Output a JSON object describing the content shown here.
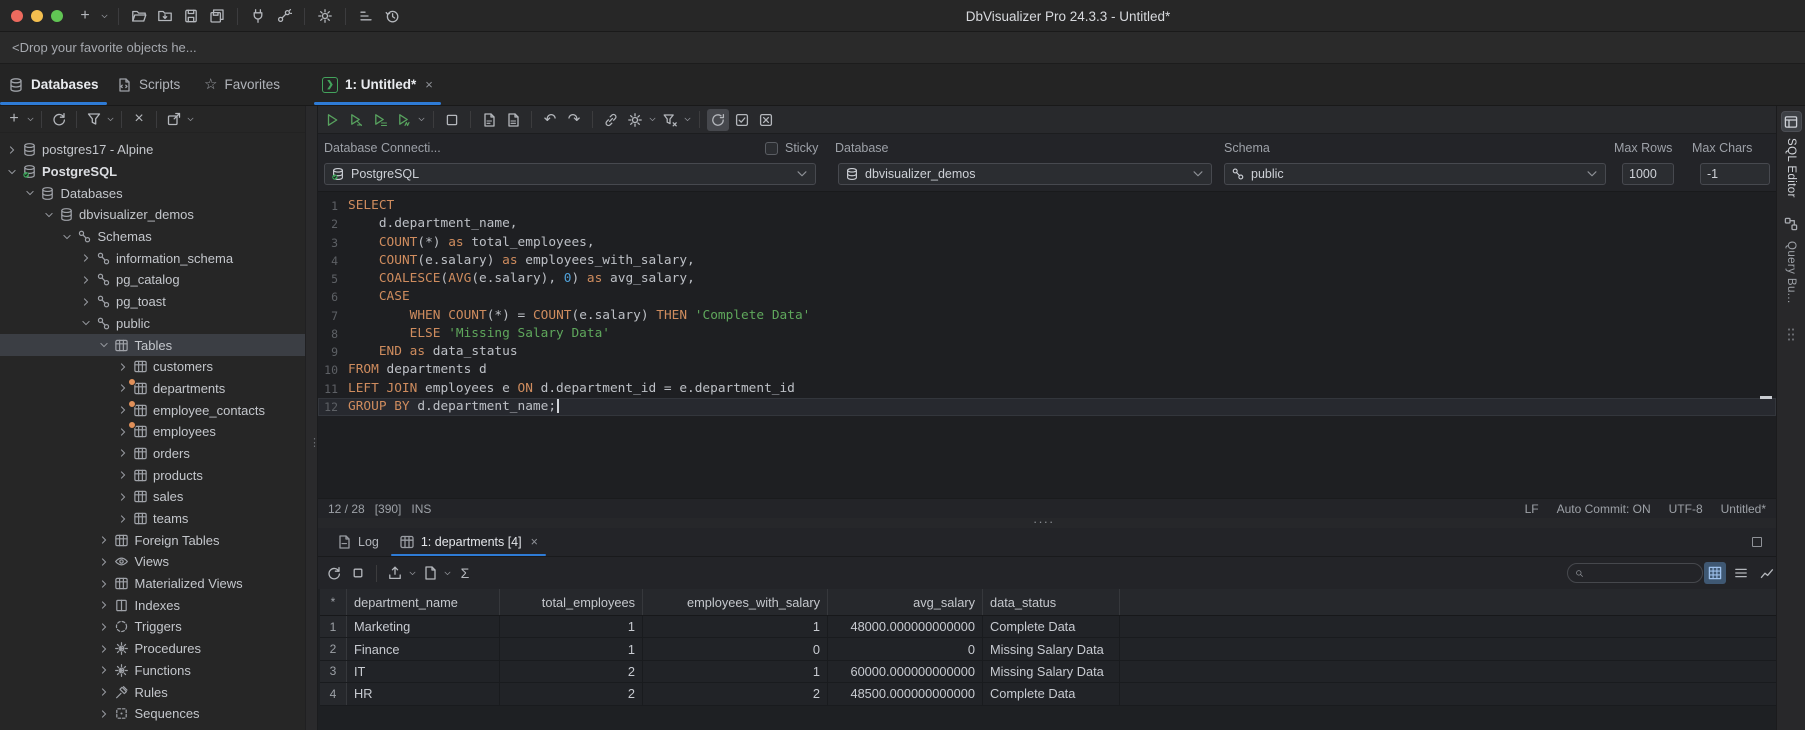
{
  "window": {
    "title": "DbVisualizer Pro 24.3.3 - Untitled*"
  },
  "titlebar": {
    "icons": [
      "plus",
      "chev",
      "|",
      "folder-open",
      "folder-import",
      "save",
      "save-all",
      "|",
      "plug",
      "connector",
      "|",
      "gear",
      "|",
      "chart-bars",
      "history"
    ]
  },
  "dropbar": {
    "text": "<Drop your favorite objects he..."
  },
  "tabs": {
    "left": [
      {
        "label": "Databases",
        "icon": "database",
        "active": true
      },
      {
        "label": "Scripts",
        "icon": "script",
        "active": false
      },
      {
        "label": "Favorites",
        "icon": "star",
        "active": false
      }
    ],
    "editor_tab": {
      "label": "1: Untitled*",
      "icon": "sql-badge",
      "close": "x",
      "active": true
    }
  },
  "sidebar": {
    "toolbar": [
      "plus",
      "chev",
      "|",
      "refresh",
      "|",
      "funnel",
      "chev",
      "|",
      "close",
      "|",
      "open-new",
      "chev"
    ],
    "tree": [
      {
        "label": "postgres17 - Alpine",
        "level": 0,
        "exp": "closed",
        "icon": "database"
      },
      {
        "label": "PostgreSQL",
        "level": 0,
        "exp": "open",
        "icon": "database-check",
        "bold": true
      },
      {
        "label": "Databases",
        "level": 1,
        "exp": "open",
        "icon": "database"
      },
      {
        "label": "dbvisualizer_demos",
        "level": 2,
        "exp": "open",
        "icon": "database"
      },
      {
        "label": "Schemas",
        "level": 3,
        "exp": "open",
        "icon": "schema"
      },
      {
        "label": "information_schema",
        "level": 4,
        "exp": "closed",
        "icon": "schema"
      },
      {
        "label": "pg_catalog",
        "level": 4,
        "exp": "closed",
        "icon": "schema"
      },
      {
        "label": "pg_toast",
        "level": 4,
        "exp": "closed",
        "icon": "schema"
      },
      {
        "label": "public",
        "level": 4,
        "exp": "open",
        "icon": "schema"
      },
      {
        "label": "Tables",
        "level": 5,
        "exp": "open",
        "icon": "table",
        "selected": true
      },
      {
        "label": "customers",
        "level": 6,
        "exp": "closed",
        "icon": "table"
      },
      {
        "label": "departments",
        "level": 6,
        "exp": "closed",
        "icon": "table",
        "badge": true
      },
      {
        "label": "employee_contacts",
        "level": 6,
        "exp": "closed",
        "icon": "table",
        "badge": true
      },
      {
        "label": "employees",
        "level": 6,
        "exp": "closed",
        "icon": "table",
        "badge": true
      },
      {
        "label": "orders",
        "level": 6,
        "exp": "closed",
        "icon": "table"
      },
      {
        "label": "products",
        "level": 6,
        "exp": "closed",
        "icon": "table"
      },
      {
        "label": "sales",
        "level": 6,
        "exp": "closed",
        "icon": "table"
      },
      {
        "label": "teams",
        "level": 6,
        "exp": "closed",
        "icon": "table"
      },
      {
        "label": "Foreign Tables",
        "level": 5,
        "exp": "closed",
        "icon": "table"
      },
      {
        "label": "Views",
        "level": 5,
        "exp": "closed",
        "icon": "eye"
      },
      {
        "label": "Materialized Views",
        "level": 5,
        "exp": "closed",
        "icon": "table"
      },
      {
        "label": "Indexes",
        "level": 5,
        "exp": "closed",
        "icon": "columns"
      },
      {
        "label": "Triggers",
        "level": 5,
        "exp": "closed",
        "icon": "trigger"
      },
      {
        "label": "Procedures",
        "level": 5,
        "exp": "closed",
        "icon": "gear-play"
      },
      {
        "label": "Functions",
        "level": 5,
        "exp": "closed",
        "icon": "gear-play"
      },
      {
        "label": "Rules",
        "level": 5,
        "exp": "closed",
        "icon": "hammer"
      },
      {
        "label": "Sequences",
        "level": 5,
        "exp": "closed",
        "icon": "sequence"
      }
    ]
  },
  "editor": {
    "toolbar": [
      {
        "ic": "play"
      },
      {
        "ic": "play-cursor"
      },
      {
        "ic": "play-script"
      },
      {
        "ic": "play-explain"
      },
      "chev",
      "|",
      {
        "ic": "stop"
      },
      "|",
      {
        "ic": "format-doc"
      },
      {
        "ic": "format-doc-alt"
      },
      "|",
      {
        "ic": "undo"
      },
      {
        "ic": "redo"
      },
      "|",
      {
        "ic": "link"
      },
      {
        "ic": "gear"
      },
      "chev",
      {
        "ic": "funnel-x"
      },
      "chev",
      "|",
      {
        "ic": "commit-check",
        "active": true
      },
      {
        "ic": "check-square"
      },
      {
        "ic": "x-square"
      }
    ],
    "connection": {
      "connection_label": "Database Connecti...",
      "sticky_label": "Sticky",
      "database_label": "Database",
      "schema_label": "Schema",
      "max_rows_label": "Max Rows",
      "max_chars_label": "Max Chars",
      "connection_value": "PostgreSQL",
      "database_value": "dbvisualizer_demos",
      "schema_value": "public",
      "max_rows_value": "1000",
      "max_chars_value": "-1"
    },
    "code": {
      "current_line": 12,
      "lines": [
        {
          "n": "1",
          "seg": [
            [
              "k",
              "SELECT"
            ]
          ]
        },
        {
          "n": "2",
          "seg": [
            [
              "d",
              "    d.department_name,"
            ]
          ]
        },
        {
          "n": "3",
          "seg": [
            [
              "d",
              "    "
            ],
            [
              "k",
              "COUNT"
            ],
            [
              "d",
              "(*) "
            ],
            [
              "k",
              "as"
            ],
            [
              "d",
              " total_employees,"
            ]
          ]
        },
        {
          "n": "4",
          "seg": [
            [
              "d",
              "    "
            ],
            [
              "k",
              "COUNT"
            ],
            [
              "d",
              "(e.salary) "
            ],
            [
              "k",
              "as"
            ],
            [
              "d",
              " employees_with_salary,"
            ]
          ]
        },
        {
          "n": "5",
          "seg": [
            [
              "d",
              "    "
            ],
            [
              "k",
              "COALESCE"
            ],
            [
              "d",
              "("
            ],
            [
              "k",
              "AVG"
            ],
            [
              "d",
              "(e.salary), "
            ],
            [
              "num",
              "0"
            ],
            [
              "d",
              ") "
            ],
            [
              "k",
              "as"
            ],
            [
              "d",
              " avg_salary,"
            ]
          ]
        },
        {
          "n": "6",
          "seg": [
            [
              "d",
              "    "
            ],
            [
              "k",
              "CASE"
            ]
          ]
        },
        {
          "n": "7",
          "seg": [
            [
              "d",
              "        "
            ],
            [
              "k",
              "WHEN"
            ],
            [
              "d",
              " "
            ],
            [
              "k",
              "COUNT"
            ],
            [
              "d",
              "(*) = "
            ],
            [
              "k",
              "COUNT"
            ],
            [
              "d",
              "(e.salary) "
            ],
            [
              "k",
              "THEN"
            ],
            [
              "d",
              " "
            ],
            [
              "s",
              "'Complete Data'"
            ]
          ]
        },
        {
          "n": "8",
          "seg": [
            [
              "d",
              "        "
            ],
            [
              "k",
              "ELSE"
            ],
            [
              "d",
              " "
            ],
            [
              "s",
              "'Missing Salary Data'"
            ]
          ]
        },
        {
          "n": "9",
          "seg": [
            [
              "d",
              "    "
            ],
            [
              "k",
              "END"
            ],
            [
              "d",
              " "
            ],
            [
              "k",
              "as"
            ],
            [
              "d",
              " data_status"
            ]
          ]
        },
        {
          "n": "10",
          "seg": [
            [
              "k",
              "FROM"
            ],
            [
              "d",
              " departments d"
            ]
          ]
        },
        {
          "n": "11",
          "seg": [
            [
              "k",
              "LEFT JOIN"
            ],
            [
              "d",
              " employees e "
            ],
            [
              "k",
              "ON"
            ],
            [
              "d",
              " d.department_id = e.department_id"
            ]
          ]
        },
        {
          "n": "12",
          "seg": [
            [
              "k",
              "GROUP BY"
            ],
            [
              "d",
              " d.department_name;"
            ]
          ]
        }
      ]
    },
    "statusbar": {
      "caret": "12 / 28",
      "chars": "[390]",
      "mode": "INS",
      "right": [
        "LF",
        "Auto Commit: ON",
        "UTF-8",
        "Untitled*"
      ]
    }
  },
  "results": {
    "tabs": [
      {
        "label": "Log",
        "icon": "log-doc",
        "active": false
      },
      {
        "label": "1: departments [4]",
        "icon": "grid-small",
        "active": true,
        "close": "x"
      }
    ],
    "toolbar_left": [
      {
        "ic": "refresh"
      },
      {
        "ic": "stop-small"
      },
      "|",
      {
        "ic": "export"
      },
      "chev",
      {
        "ic": "doc"
      },
      "chev",
      {
        "ic": "sigma"
      }
    ],
    "toolbar_right": [
      {
        "ic": "grid-view",
        "active": true
      },
      {
        "ic": "list-view"
      },
      {
        "ic": "chart-view"
      },
      "chev"
    ],
    "grid": {
      "columns": [
        {
          "label": "*",
          "align": "center"
        },
        {
          "label": "department_name",
          "align": "left"
        },
        {
          "label": "total_employees",
          "align": "right"
        },
        {
          "label": "employees_with_salary",
          "align": "right"
        },
        {
          "label": "avg_salary",
          "align": "right"
        },
        {
          "label": "data_status",
          "align": "left"
        }
      ],
      "rows": [
        [
          "Marketing",
          "1",
          "1",
          "48000.000000000000",
          "Complete Data"
        ],
        [
          "Finance",
          "1",
          "0",
          "0",
          "Missing Salary Data"
        ],
        [
          "IT",
          "2",
          "1",
          "60000.000000000000",
          "Missing Salary Data"
        ],
        [
          "HR",
          "2",
          "2",
          "48500.000000000000",
          "Complete Data"
        ]
      ]
    }
  },
  "right_rail": {
    "tabs": [
      {
        "label": "SQL Editor",
        "icon": "sql-editor",
        "active": true
      },
      {
        "label": "Query Bu...",
        "icon": "query-builder",
        "active": false
      }
    ]
  }
}
